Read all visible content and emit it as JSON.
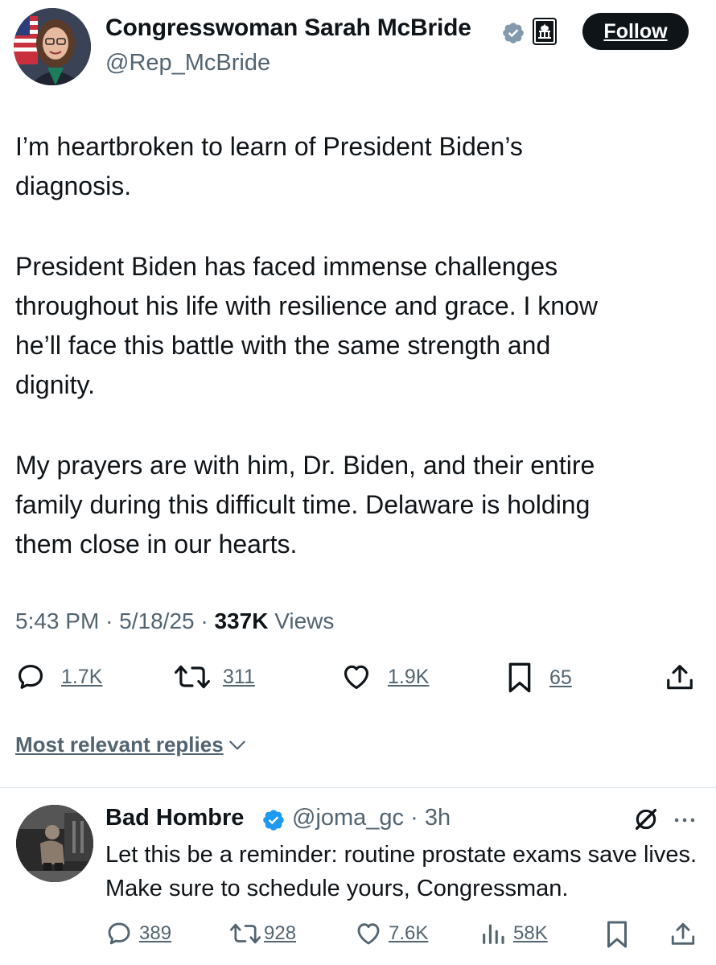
{
  "header": {
    "author_name": "Congresswoman Sarah McBride",
    "handle": "@Rep_McBride",
    "follow_label": "Follow"
  },
  "tweet": {
    "paragraphs": [
      "I’m heartbroken to learn of President Biden’s\ndiagnosis.",
      "President Biden has faced immense challenges\nthroughout his life with resilience and grace. I know\nhe’ll face this battle with the same strength and\ndignity.",
      "My prayers are with him, Dr. Biden, and their entire\nfamily during this difficult time. Delaware is holding\nthem close in our hearts."
    ],
    "time": "5:43 PM",
    "date": "5/18/25",
    "views_count": "337K",
    "views_label": "Views"
  },
  "actions": {
    "replies": "1.7K",
    "reposts": "311",
    "likes": "1.9K",
    "bookmarks": "65"
  },
  "replies_sort": {
    "label": "Most relevant replies"
  },
  "reply": {
    "author_name": "Bad Hombre",
    "handle": "@joma_gc",
    "time": "3h",
    "text": "Let this be a reminder: routine prostate exams save lives. Make sure to schedule yours, Congressman.",
    "replies": "389",
    "reposts": "928",
    "likes": "7.6K",
    "views": "58K"
  },
  "colors": {
    "text_primary": "#0f1419",
    "text_secondary": "#536471",
    "verified_blue": "#1d9bf0",
    "government_gray": "#829aab",
    "follow_bg": "#0f1419"
  },
  "icons": [
    "verified-badge",
    "government-badge",
    "reply-icon",
    "repost-icon",
    "like-icon",
    "bookmark-icon",
    "share-icon",
    "chevron-down-icon",
    "grok-icon",
    "more-icon",
    "views-icon"
  ]
}
